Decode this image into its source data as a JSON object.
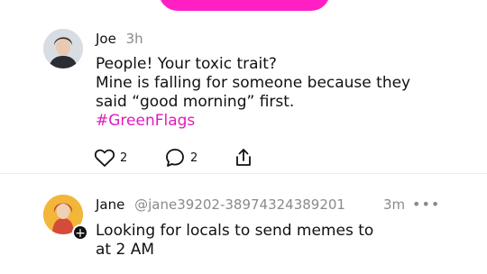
{
  "posts": [
    {
      "author": "Joe",
      "time": "3h",
      "lines": [
        "People! Your toxic trait?",
        "Mine is falling for someone because they",
        "said “good morning” first."
      ],
      "hashtag": "#GreenFlags",
      "likes": "2",
      "replies": "2"
    },
    {
      "author": "Jane",
      "handle": "@jane39202-38974324389201",
      "time": "3m",
      "more": "•••",
      "lines": [
        "Looking for locals to send memes to",
        "at 2 AM"
      ]
    }
  ],
  "colors": {
    "accent": "#ff1fc5",
    "hashtag": "#e21bb8"
  }
}
